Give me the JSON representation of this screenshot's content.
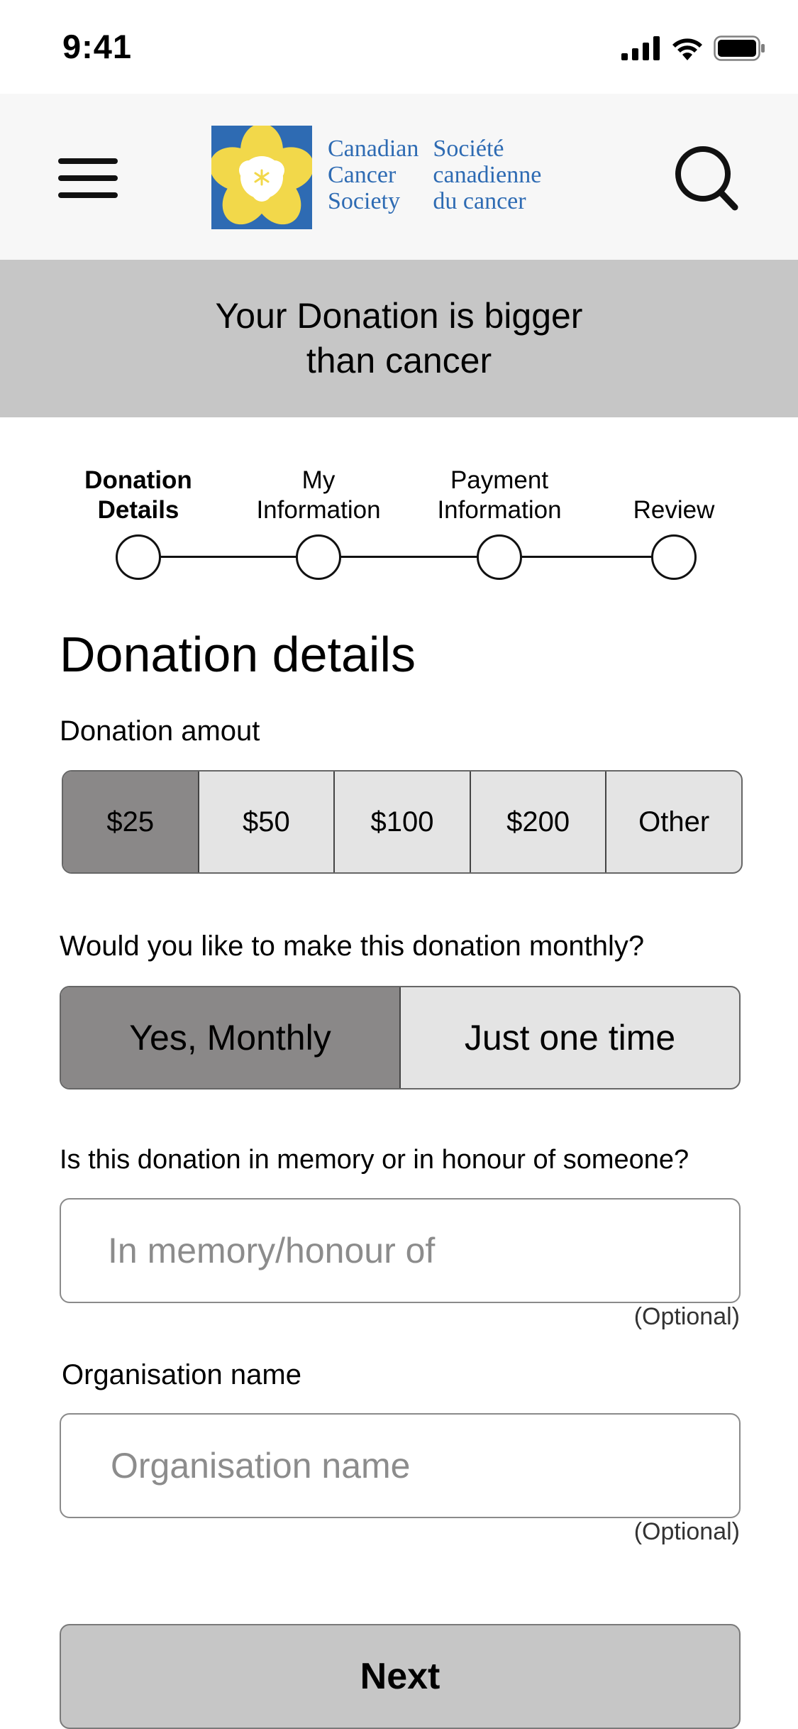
{
  "status_bar": {
    "time": "9:41"
  },
  "header": {
    "logo": {
      "english": [
        "Canadian",
        "Cancer",
        "Society"
      ],
      "french": [
        "Société",
        "canadienne",
        "du cancer"
      ]
    }
  },
  "banner": {
    "text": "Your Donation is bigger than cancer"
  },
  "stepper": {
    "steps": [
      {
        "line1": "Donation",
        "line2": "Details",
        "active": true
      },
      {
        "line1": "My",
        "line2": "Information",
        "active": false
      },
      {
        "line1": "Payment",
        "line2": "Information",
        "active": false
      },
      {
        "line1": "",
        "line2": "Review",
        "active": false
      }
    ]
  },
  "form": {
    "title": "Donation details",
    "amount_label": "Donation amout",
    "amounts": [
      "$25",
      "$50",
      "$100",
      "$200",
      "Other"
    ],
    "amount_selected": "$25",
    "monthly_question": "Would you like to make this donation monthly?",
    "frequency_options": [
      "Yes, Monthly",
      "Just one time"
    ],
    "frequency_selected": "Yes, Monthly",
    "memory_question": "Is this donation in memory or in honour of someone?",
    "memory_placeholder": "In memory/honour of",
    "memory_value": "",
    "memory_optional": "(Optional)",
    "org_label": "Organisation name",
    "org_placeholder": "Organisation name",
    "org_value": "",
    "org_optional": "(Optional)",
    "next_label": "Next"
  },
  "colors": {
    "brand_blue": "#2e6bb3",
    "daffodil_yellow": "#f2d84a",
    "selected_gray": "#8a8888",
    "banner_gray": "#c6c6c6"
  }
}
